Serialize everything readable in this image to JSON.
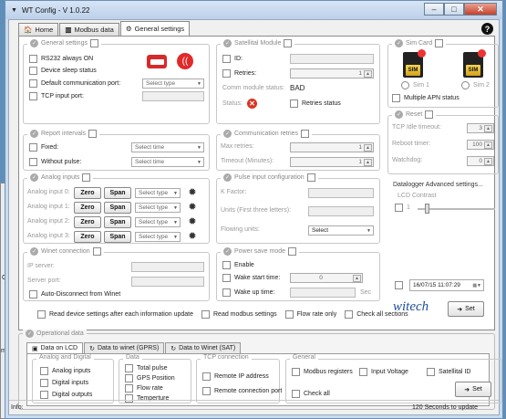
{
  "window": {
    "title": "WT Config - V 1.0.22"
  },
  "tabs": [
    "Home",
    "Modbus data",
    "General settings"
  ],
  "general": {
    "title": "General settings",
    "rs232": "RS232 always ON",
    "sleep": "Device sleep status",
    "default_port": "Default communication port:",
    "default_port_select": "Select type",
    "tcp_port": "TCP input port:"
  },
  "report": {
    "title": "Report intervals",
    "fixed": "Fixed:",
    "without": "Without pulse:",
    "select": "Select time"
  },
  "analog": {
    "title": "Analog inputs",
    "rows": [
      "Analog input 0:",
      "Analog input 1:",
      "Analog input 2:",
      "Analog input 3:"
    ],
    "zero": "Zero",
    "span": "Span",
    "select": "Select type"
  },
  "winet": {
    "title": "Winet connection",
    "server_ip": "IP server:",
    "server_port": "Server port:",
    "auto_disconnect": "Auto-Disconnect from Winet"
  },
  "satellite": {
    "title": "Satellital Module",
    "id": "ID:",
    "retries": "Retries:",
    "retries_val": "1",
    "comm_status": "Comm module status:",
    "comm_val": "BAD",
    "status": "Status:",
    "retries_status": "Retries status"
  },
  "comm_retries": {
    "title": "Communication retries",
    "max": "Max retries:",
    "max_val": "1",
    "timeout": "Timeout (Minutes):",
    "timeout_val": "1"
  },
  "pulse": {
    "title": "Pulse input configuration",
    "kfactor": "K Factor:",
    "units": "Units (First three letters):",
    "flowing": "Flowing units:",
    "flowing_sel": "Select"
  },
  "power": {
    "title": "Power save mode",
    "enable": "Enable",
    "wake_start": "Wake start time:",
    "wake_start_val": "0",
    "wake_up": "Wake up time:",
    "sec": "Sec"
  },
  "sim": {
    "title": "Sim Card",
    "sim1": "Sim 1",
    "sim2": "Sim 2",
    "multi_apn": "Multiple APN status",
    "chip": "SIM"
  },
  "reset": {
    "title": "Reset",
    "tcp_idle": "TCP Idle timeout:",
    "tcp_idle_val": "3",
    "reboot": "Reboot timer:",
    "reboot_val": "100",
    "watchdog": "Watchdog:",
    "watchdog_val": "0"
  },
  "datalogger": {
    "title": "Datalogger Advanced settings...",
    "lcd": "LCD Contrast",
    "lcd_val": "1",
    "datetime": "16/07/15 11:07:29"
  },
  "bottom_opts": {
    "read_after": "Read device settings after each information update",
    "read_modbus": "Read modbus settings",
    "flow_rate": "Flow rate only",
    "check_all": "Check all sections",
    "set": "Set"
  },
  "logo": "witech",
  "operational": {
    "title": "Operational data",
    "tabs": [
      "Data on LCD",
      "Data to winet (GPRS)",
      "Data to Winet (SAT)"
    ],
    "analog_digital": {
      "title": "Analog and Digital",
      "items": [
        "Analog inputs",
        "Digital inputs",
        "Digital outputs"
      ]
    },
    "data": {
      "title": "Data",
      "items": [
        "Total pulse",
        "GPS Position",
        "Flow rate",
        "Temperture"
      ]
    },
    "tcp": {
      "title": "TCP connection",
      "items": [
        "Remote IP address",
        "Remote connection port"
      ]
    },
    "general": {
      "title": "General",
      "modbus": "Modbus registers",
      "input_voltage": "Input Voltage",
      "satellital_id": "Satellital ID",
      "check_all": "Check all",
      "set": "Set"
    }
  },
  "status": {
    "info": "Info:",
    "update": "120 Seconds to update"
  },
  "bg": {
    "cur": "Cur",
    "th": "Th",
    "mper": "mper",
    "di": "Di"
  }
}
